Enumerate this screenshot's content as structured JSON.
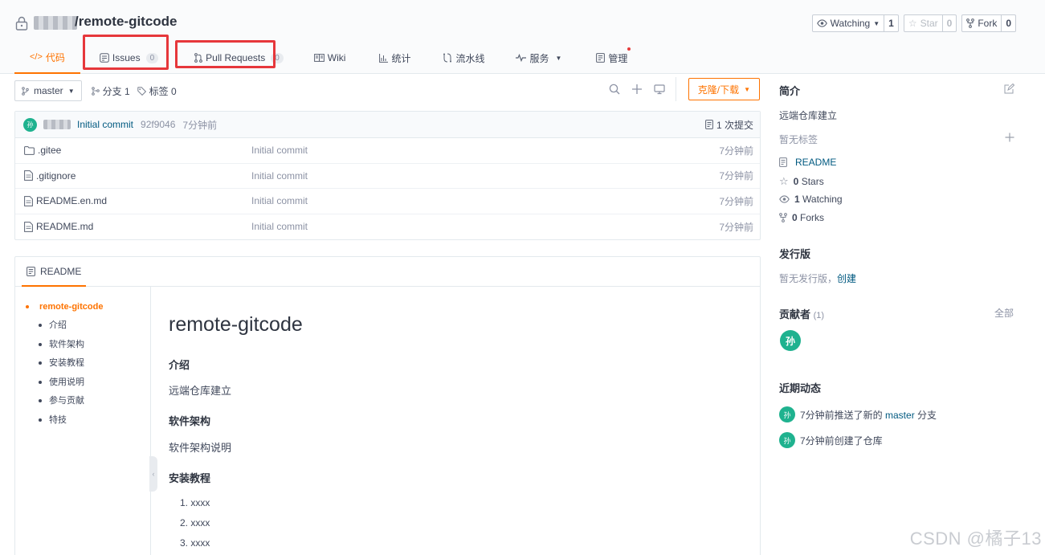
{
  "repo": {
    "title": "/remote-gitcode"
  },
  "actions": [
    {
      "label": "Watching",
      "count": "1",
      "icon": "eye-icon"
    },
    {
      "label": "Star",
      "count": "0",
      "icon": "star-icon"
    },
    {
      "label": "Fork",
      "count": "0",
      "icon": "fork-icon"
    }
  ],
  "tabs": [
    {
      "label": "代码",
      "icon": "code-icon",
      "active": true
    },
    {
      "label": "Issues",
      "badge": "0",
      "icon": "issues-icon"
    },
    {
      "label": "Pull Requests",
      "badge": "0",
      "icon": "pull-request-icon"
    },
    {
      "label": "Wiki",
      "icon": "wiki-icon"
    },
    {
      "label": "统计",
      "icon": "chart-icon"
    },
    {
      "label": "流水线",
      "icon": "pipeline-icon"
    },
    {
      "label": "服务",
      "icon": "pulse-icon"
    },
    {
      "label": "管理",
      "icon": "manage-icon"
    }
  ],
  "branch": {
    "name": "master",
    "branches": "分支 1",
    "tags": "标签 0",
    "clone_label": "克隆/下载"
  },
  "commit": {
    "avatar": "孙",
    "message": "Initial commit",
    "sha": "92f9046",
    "time": "7分钟前",
    "count": "1 次提交"
  },
  "files": [
    {
      "name": ".gitee",
      "type": "folder",
      "message": "Initial commit",
      "time": "7分钟前"
    },
    {
      "name": ".gitignore",
      "type": "file",
      "message": "Initial commit",
      "time": "7分钟前"
    },
    {
      "name": "README.en.md",
      "type": "file",
      "message": "Initial commit",
      "time": "7分钟前"
    },
    {
      "name": "README.md",
      "type": "file",
      "message": "Initial commit",
      "time": "7分钟前"
    }
  ],
  "readme": {
    "tab_label": "README",
    "toc_root": "remote-gitcode",
    "toc": [
      "介绍",
      "软件架构",
      "安装教程",
      "使用说明",
      "参与贡献",
      "特技"
    ],
    "title": "remote-gitcode",
    "intro_h": "介绍",
    "intro_p": "远端仓库建立",
    "arch_h": "软件架构",
    "arch_p": "软件架构说明",
    "install_h": "安装教程",
    "install_list": [
      "1. xxxx",
      "2. xxxx",
      "3. xxxx"
    ]
  },
  "sidebar": {
    "intro_title": "简介",
    "description": "远端仓库建立",
    "no_tags": "暂无标签",
    "readme_link": "README",
    "stars_count": "0",
    "stars_label": "Stars",
    "watching_count": "1",
    "watching_label": "Watching",
    "forks_count": "0",
    "forks_label": "Forks",
    "release_title": "发行版",
    "no_release": "暂无发行版，",
    "create_link": "创建",
    "contributors_title": "贡献者",
    "contributors_count": "(1)",
    "all_link": "全部",
    "contributor_avatar": "孙",
    "activity_title": "近期动态",
    "activity": [
      {
        "avatar": "孙",
        "prefix": "7分钟前推送了新的 ",
        "link": "master",
        "suffix": " 分支"
      },
      {
        "avatar": "孙",
        "prefix": "7分钟前创建了仓库",
        "link": "",
        "suffix": ""
      }
    ]
  },
  "watermark": "CSDN @橘子13",
  "colors": {
    "accent": "#fe7300",
    "link": "#005980",
    "avatar": "#1fb28f",
    "highlight": "#e6373b"
  }
}
